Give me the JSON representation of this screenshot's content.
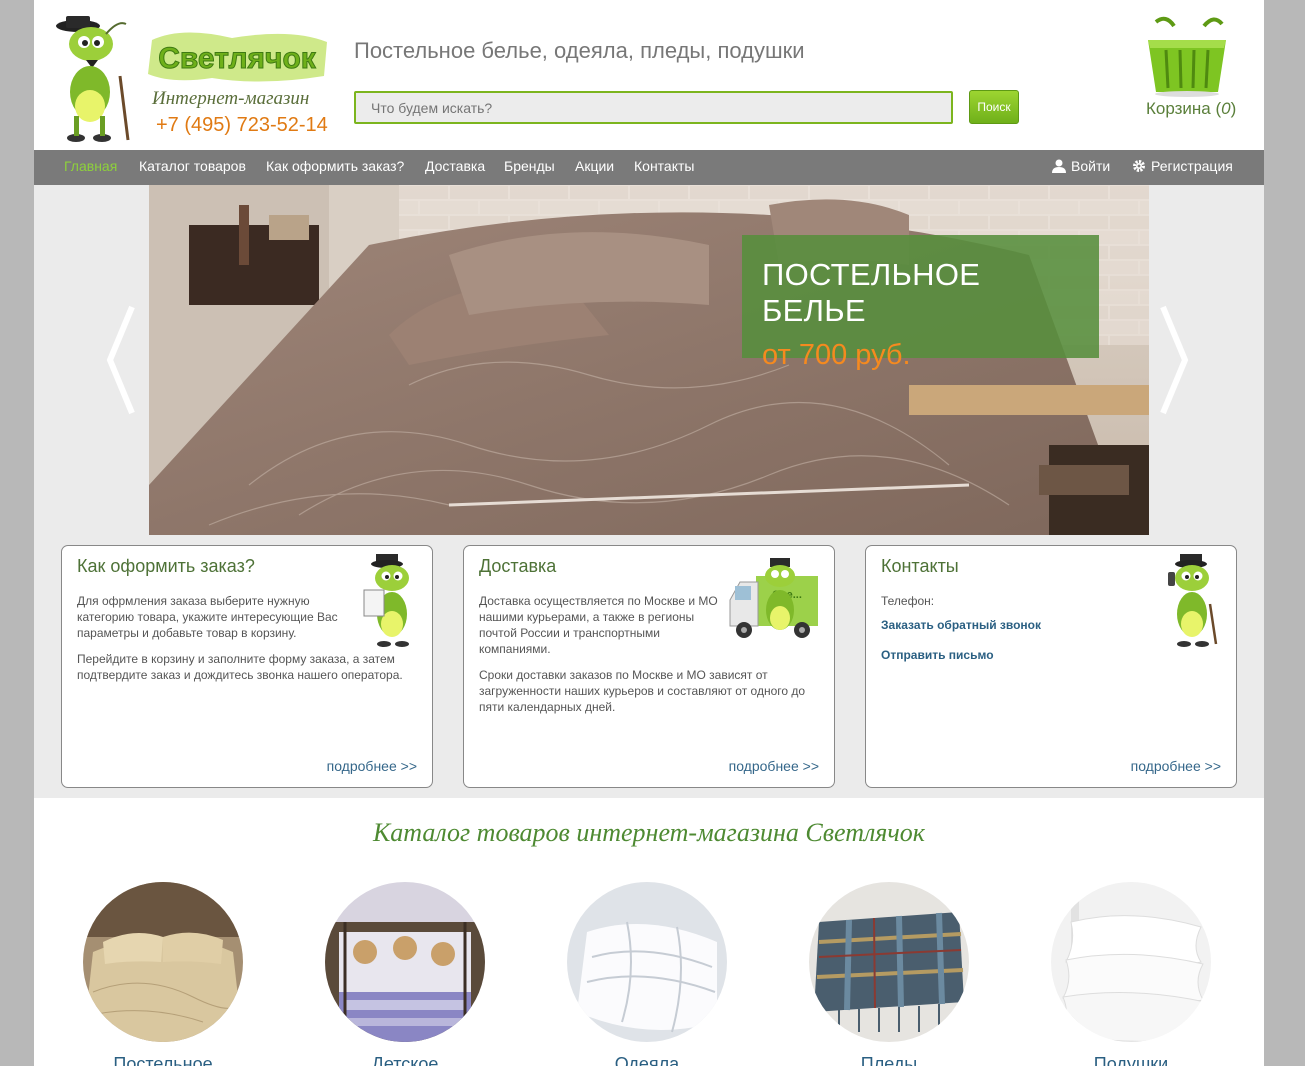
{
  "header": {
    "brand_name": "Светлячок",
    "brand_subtitle": "Интернет-магазин",
    "phone": "+7 (495) 723-52-14",
    "tagline": "Постельное белье, одеяла, пледы, подушки",
    "search_placeholder": "Что будем искать?",
    "search_button": "Поиск",
    "cart_label": "Корзина (",
    "cart_count": "0",
    "cart_close": ")"
  },
  "nav": {
    "items": [
      {
        "label": "Главная"
      },
      {
        "label": "Каталог товаров"
      },
      {
        "label": "Как оформить заказ?"
      },
      {
        "label": "Доставка"
      },
      {
        "label": "Бренды"
      },
      {
        "label": "Акции"
      },
      {
        "label": "Контакты"
      }
    ],
    "login": "Войти",
    "register": "Регистрация"
  },
  "slider": {
    "title": "ПОСТЕЛЬНОЕ БЕЛЬЕ",
    "price": "от 700 руб."
  },
  "cards": [
    {
      "title": "Как оформить заказ?",
      "p1": "Для офрмления заказа выберите нужную категорию товара, укажите интересующие Вас параметры и добавьте товар в корзину.",
      "p2": "Перейдите в корзину и заполните форму заказа, а затем подтвердите заказ и дождитесь звонка нашего оператора.",
      "more": "подробнее >>"
    },
    {
      "title": "Доставка",
      "p1": "Доставка осуществляется по Москве и МО нашими курьерами, а также в регионы почтой России и транспортными компаниями.",
      "p2": "Сроки доставки заказов по Москве и МО зависят от загруженности наших курьеров и составляют от одного до пяти календарных дней.",
      "more": "подробнее >>"
    },
    {
      "title": "Контакты",
      "phone_label": "Телефон:",
      "callback": "Заказать обратный звонок",
      "send_mail": "Отправить письмо",
      "more": "подробнее >>"
    }
  ],
  "catalog": {
    "title": "Каталог товаров интернет-магазина Светлячок",
    "items": [
      {
        "label": "Постельное"
      },
      {
        "label": "Детское"
      },
      {
        "label": "Одеяла"
      },
      {
        "label": "Пледы"
      },
      {
        "label": "Подушки"
      }
    ]
  },
  "colors": {
    "accent_green": "#7cb51e",
    "nav_bg": "#7a7a7a",
    "nav_active": "#8ed13b",
    "phone_orange": "#e07a13",
    "promo_price": "#f58a1f",
    "link_blue": "#2a5f82"
  }
}
